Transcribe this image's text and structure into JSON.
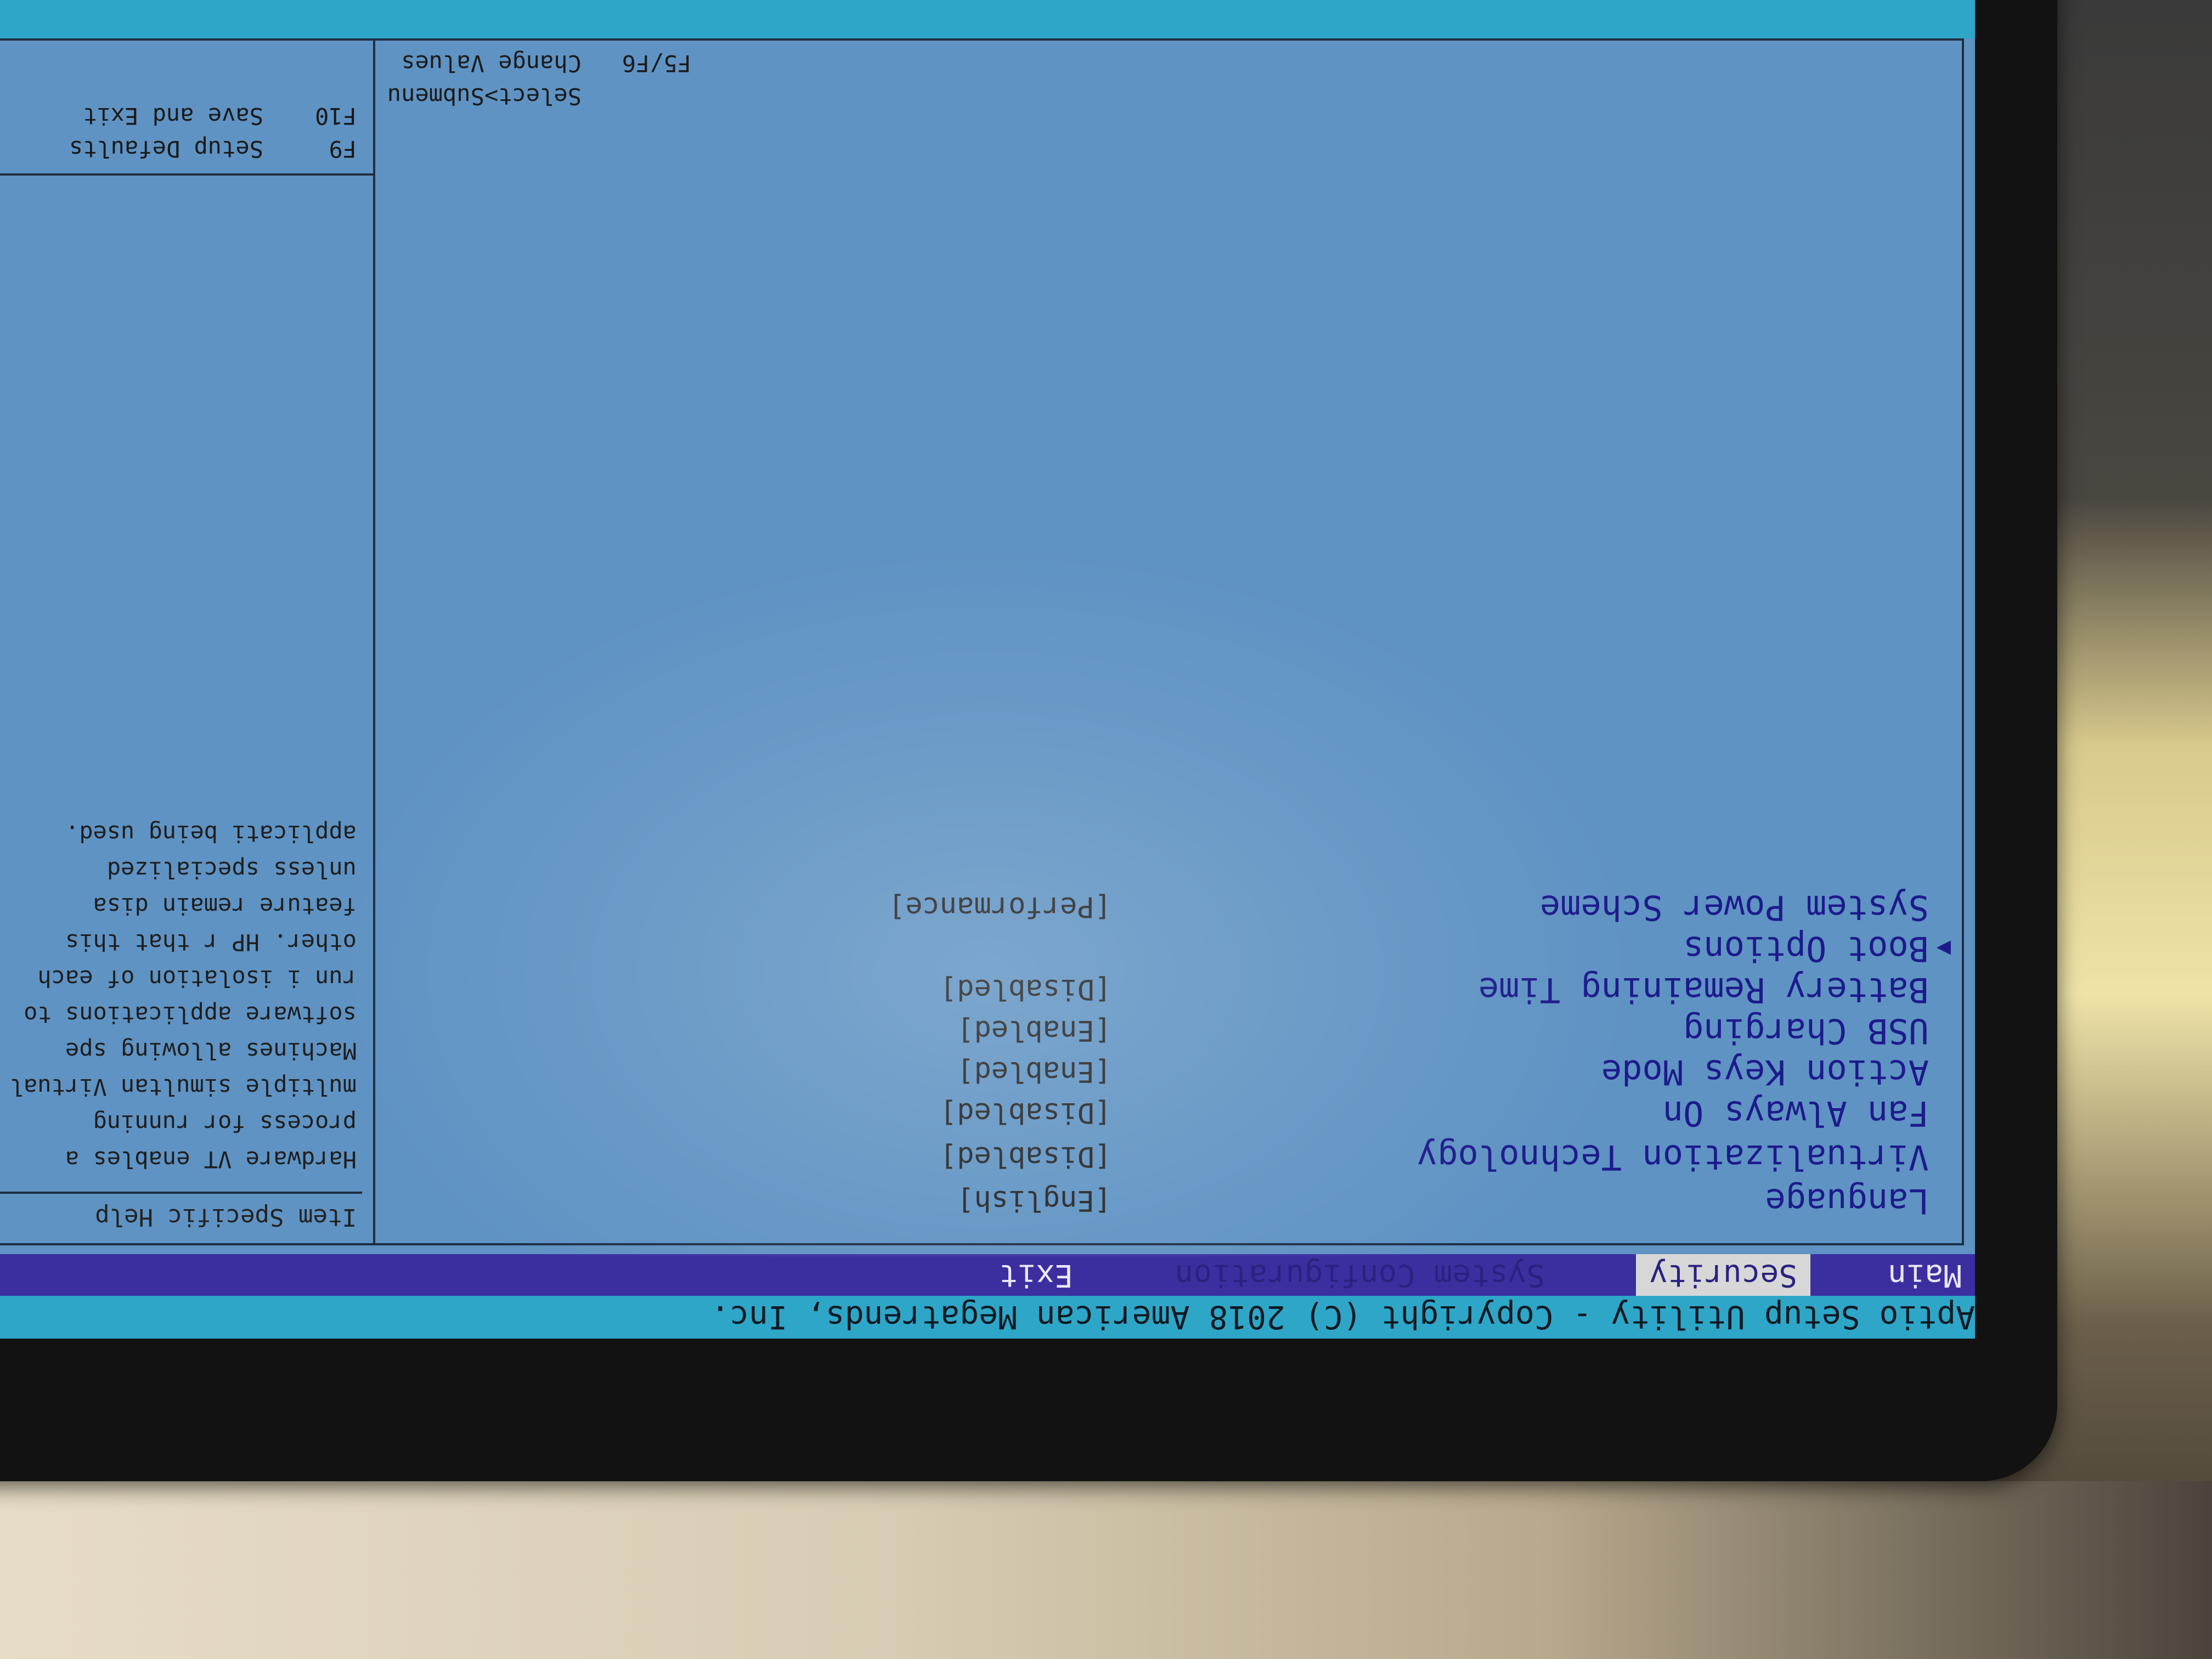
{
  "title_bar": {
    "text": "Aptio Setup Utility - Copyright (C) 2018 American Megatrends, Inc."
  },
  "tabs": [
    {
      "label": "Main",
      "active": false
    },
    {
      "label": "Security",
      "active": true
    },
    {
      "label": "System Configuration",
      "active": false
    },
    {
      "label": "Exit",
      "active": false
    }
  ],
  "settings": [
    {
      "label": "Language",
      "value": "[English]"
    },
    {
      "label": "Virtualization Technology",
      "value": "[Disabled]"
    },
    {
      "label": "Fan Always On",
      "value": "[Disabled]"
    },
    {
      "label": "Action Keys Mode",
      "value": "[Enabled]"
    },
    {
      "label": "USB Charging",
      "value": "[Enabled]"
    },
    {
      "label": "Battery Remaining Time",
      "value": "[Disabled]"
    },
    {
      "label": "Boot Options",
      "value": ""
    },
    {
      "label": "System Power Scheme",
      "value": "[Performance]"
    }
  ],
  "help": {
    "title": "Item Specific Help",
    "text": "Hardware VT enables a process for running multiple simultan Virtual Machines allowing spe software applications to run i isolation of each other. HP r that this feature remain disa unless specialized applicati being used."
  },
  "keys": [
    {
      "key": "F5/F6",
      "desc": "Change Values"
    },
    {
      "key": "",
      "desc": "Select>Submenu"
    },
    {
      "key": "F9",
      "desc": "Setup Defaults"
    },
    {
      "key": "F10",
      "desc": "Save and Exit"
    }
  ],
  "colors": {
    "screen_bg": "#5f93c3",
    "title_bar": "#2ea6c8",
    "tab_bar": "#3b2fa0",
    "setting_text": "#1d1a8c"
  }
}
